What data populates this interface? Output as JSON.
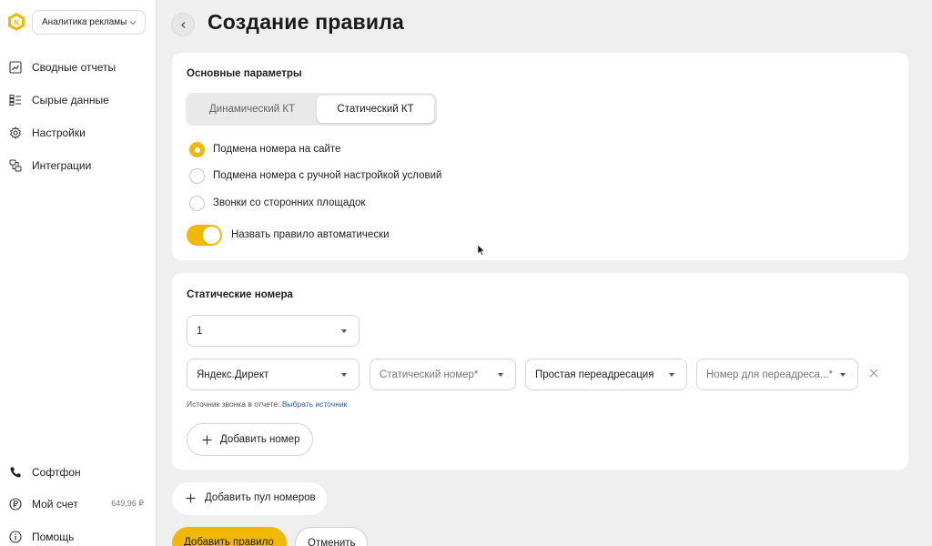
{
  "sidebar": {
    "workspace": "Аналитика рекламы",
    "nav": [
      {
        "label": "Сводные отчеты",
        "icon": "chart-report-icon"
      },
      {
        "label": "Сырые данные",
        "icon": "raw-data-icon"
      },
      {
        "label": "Настройки",
        "icon": "gear-icon"
      },
      {
        "label": "Интеграции",
        "icon": "integrations-icon"
      }
    ],
    "bottom": {
      "softphone": "Софтфон",
      "account": "Мой счет",
      "balance": "649,96 ₽",
      "help": "Помощь"
    }
  },
  "header": {
    "title": "Создание правила"
  },
  "basic_params": {
    "title": "Основные параметры",
    "tabs": [
      "Динамический КТ",
      "Статический КТ"
    ],
    "active_tab": "Статический КТ",
    "options": [
      {
        "label": "Подмена номера на сайте",
        "selected": true
      },
      {
        "label": "Подмена номера с ручной настройкой условий",
        "selected": false
      },
      {
        "label": "Звонки со сторонних площадок",
        "selected": false
      }
    ],
    "auto_name_label": "Назвать правило автоматически",
    "auto_name_on": true
  },
  "static_numbers": {
    "title": "Статические номера",
    "count": "1",
    "source": "Яндекс.Директ",
    "static_number_placeholder": "Статический номер*",
    "redirect_type": "Простая переадресация",
    "redirect_number_placeholder": "Номер для переадреса...*",
    "source_hint": "Источник звонка в отчете:",
    "source_hint_link": "Выбрать источник",
    "add_number": "Добавить номер"
  },
  "actions": {
    "add_pool": "Добавить пул номеров",
    "add_rule": "Добавить правило",
    "cancel": "Отменить"
  },
  "colors": {
    "accent": "#f2b807",
    "link": "#2b5fb8",
    "background": "#efefef"
  }
}
